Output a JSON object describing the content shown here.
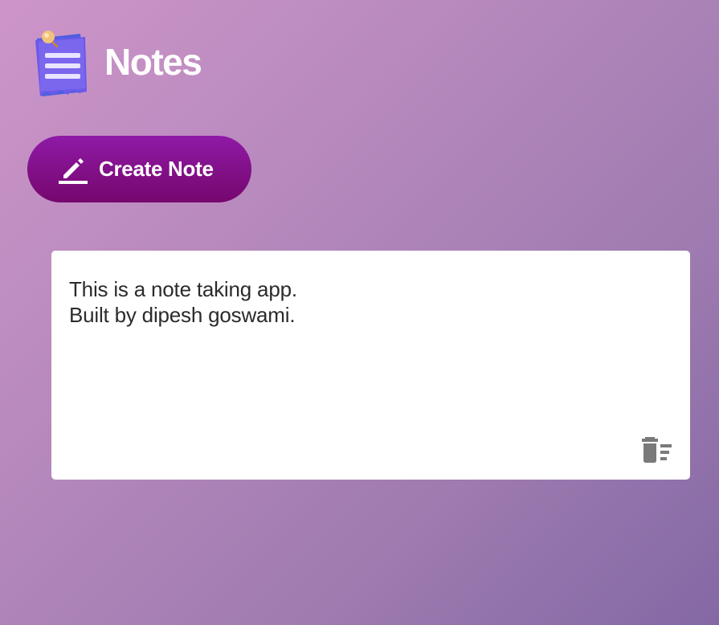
{
  "app": {
    "title": "Notes",
    "logo_icon": "sticky-note-pin-icon"
  },
  "toolbar": {
    "create_label": "Create Note",
    "create_icon": "pencil-icon"
  },
  "notes": [
    {
      "text": "This is a note taking app.\nBuilt by dipesh goswami.",
      "delete_icon": "delete-sweep-icon"
    }
  ],
  "colors": {
    "button_top": "#8f1aa6",
    "button_bottom": "#76076e",
    "background_start": "#cd95c9",
    "background_end": "#8468a4",
    "note_bg": "#ffffff",
    "icon_gray": "#7a7a7a"
  }
}
